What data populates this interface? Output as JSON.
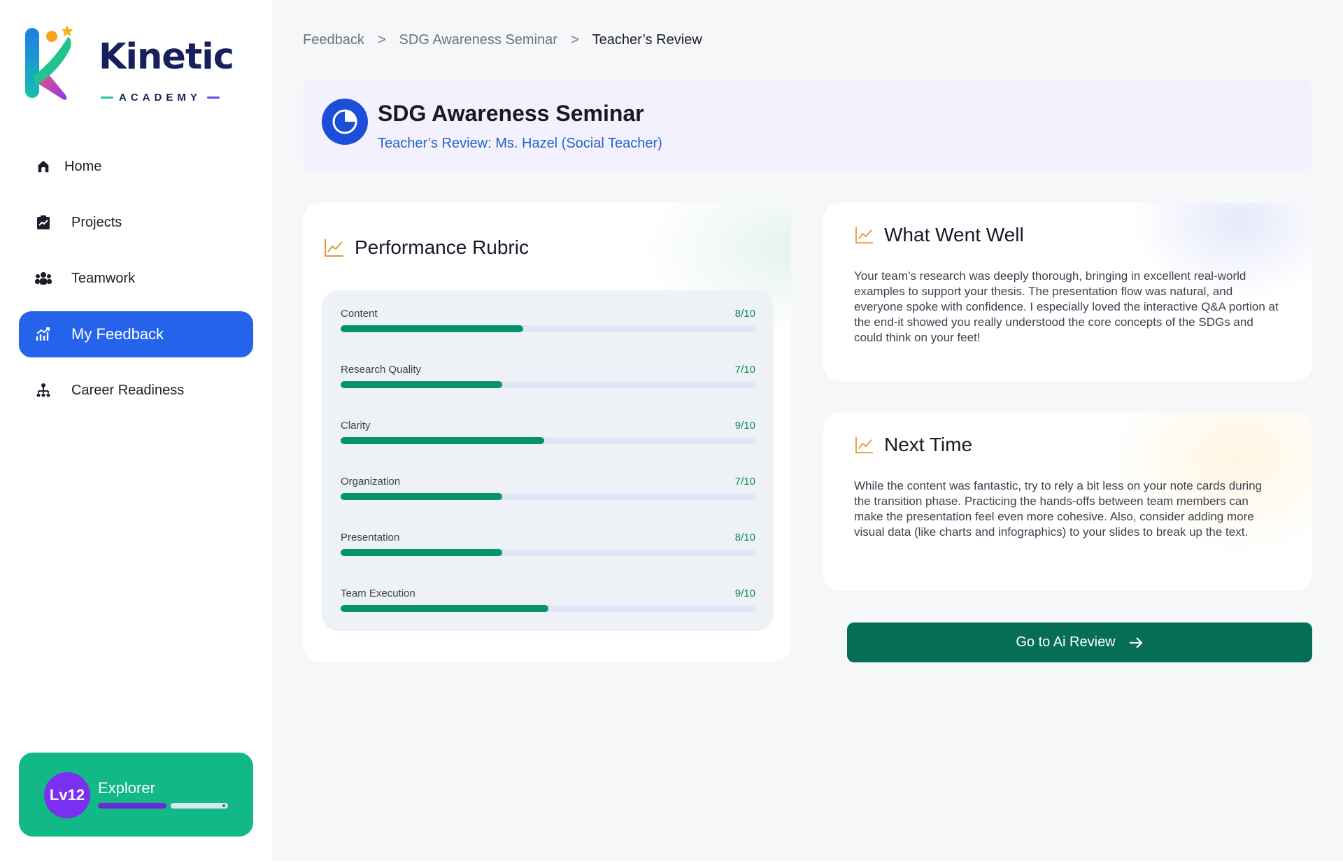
{
  "brand": {
    "name": "Kinetic",
    "sub": "ACADEMY"
  },
  "sidebar": {
    "items": [
      {
        "label": "Home",
        "icon": "home-icon"
      },
      {
        "label": "Projects",
        "icon": "clipboard-chart-icon"
      },
      {
        "label": "Teamwork",
        "icon": "group-icon"
      },
      {
        "label": "My Feedback",
        "icon": "trend-chart-icon",
        "active": true
      },
      {
        "label": "Career Readiness",
        "icon": "org-chart-icon"
      }
    ]
  },
  "level": {
    "badge": "Lv12",
    "title": "Explorer",
    "progress": 0.53
  },
  "breadcrumb": {
    "root": "Feedback",
    "mid": "SDG Awareness Seminar",
    "current": "Teacher’s Review",
    "separator": ">"
  },
  "header": {
    "title": "SDG Awareness Seminar",
    "subtitle": "Teacher’s Review: Ms. Hazel (Social Teacher)"
  },
  "rubric": {
    "title": "Performance Rubric",
    "rows": [
      {
        "label": "Content",
        "score": "8/10",
        "fill": 0.44
      },
      {
        "label": "Research Quality",
        "score": "7/10",
        "fill": 0.39
      },
      {
        "label": "Clarity",
        "score": "9/10",
        "fill": 0.49
      },
      {
        "label": "Organization",
        "score": "7/10",
        "fill": 0.39
      },
      {
        "label": "Presentation",
        "score": "8/10",
        "fill": 0.39
      },
      {
        "label": "Team Execution",
        "score": "9/10",
        "fill": 0.5
      }
    ]
  },
  "went_well": {
    "title": "What Went Well",
    "body": "Your team’s research was deeply thorough, bringing in excellent real-world examples to support your thesis. The presentation flow was natural, and everyone spoke with confidence. I especially loved the interactive Q&A portion at the end-it showed you really understood the core concepts of the SDGs and could think on your feet!"
  },
  "next_time": {
    "title": "Next Time",
    "body": "While the content was fantastic, try to rely a bit less on your note cards during the transition phase. Practicing the hands-offs between team members can make the presentation feel even more cohesive. Also, consider adding more visual data (like charts and infographics) to your slides to break up the text."
  },
  "cta": {
    "label": "Go to Ai Review"
  },
  "colors": {
    "primary": "#2563eb",
    "success": "#12b886",
    "dark_green": "#056e54",
    "accent_orange": "#e39a35"
  }
}
